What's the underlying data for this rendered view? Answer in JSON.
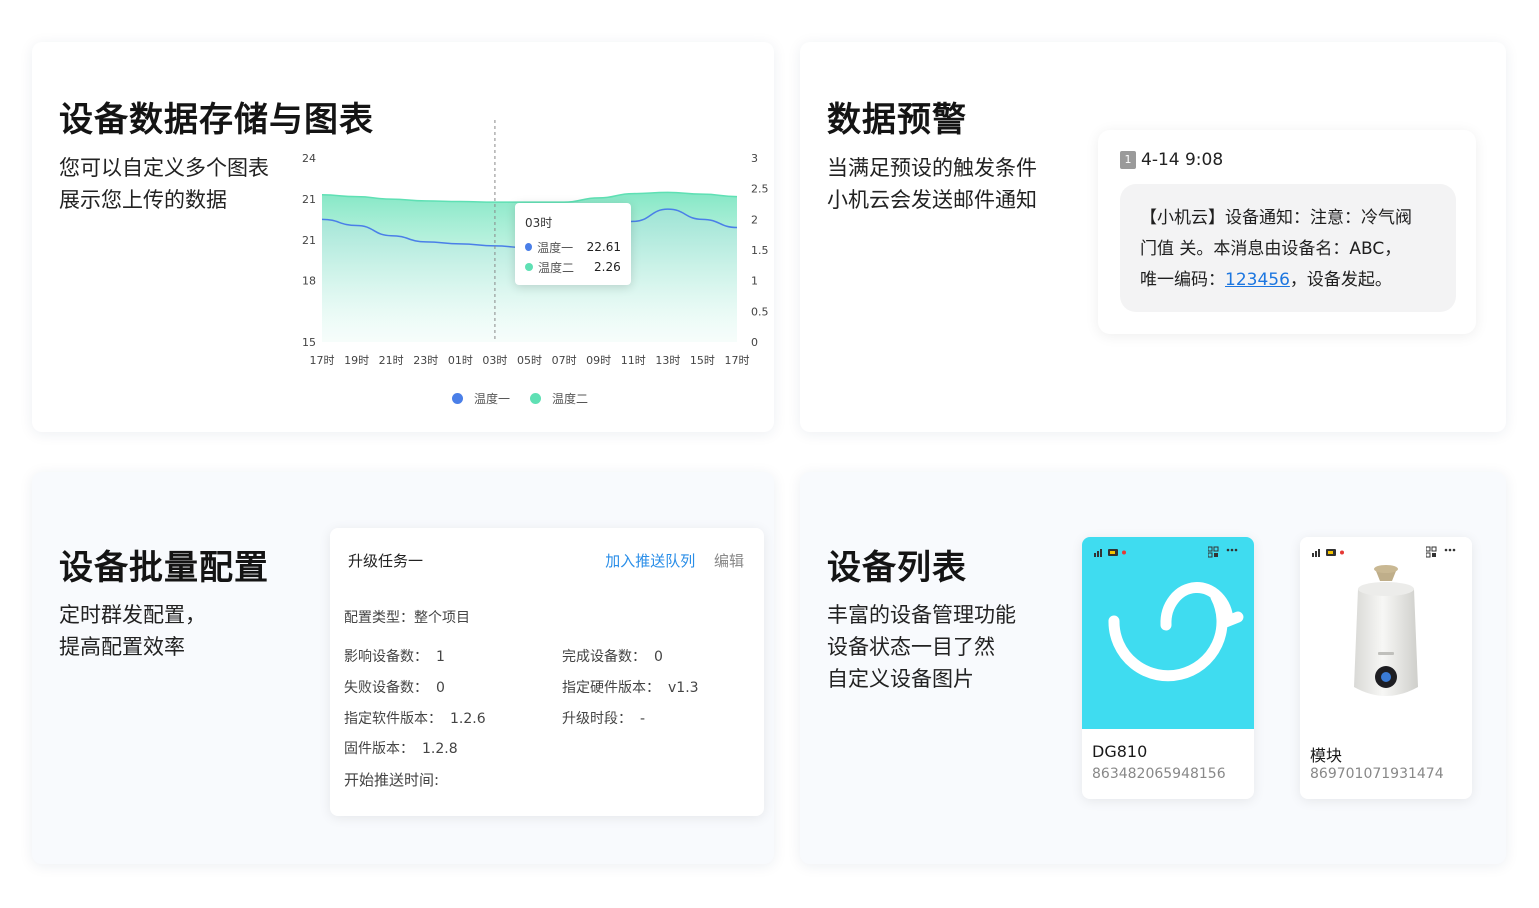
{
  "storage": {
    "title": "设备数据存储与图表",
    "desc_line1": "您可以自定义多个图表",
    "desc_line2": "展示您上传的数据"
  },
  "chart_data": {
    "type": "area",
    "x": [
      "17时",
      "19时",
      "21时",
      "23时",
      "01时",
      "03时",
      "05时",
      "07时",
      "09时",
      "11时",
      "13时",
      "15时",
      "17时"
    ],
    "left_axis_ticks": [
      "24",
      "21",
      "21",
      "18",
      "15"
    ],
    "right_axis_ticks": [
      "3",
      "2.5",
      "2",
      "1.5",
      "1",
      "0.5",
      "0"
    ],
    "series": [
      {
        "name": "温度一",
        "color": "#4a7fe8",
        "values": [
          21.0,
          20.7,
          20.2,
          19.9,
          19.8,
          19.7,
          19.6,
          19.8,
          20.4,
          20.9,
          21.5,
          21.0,
          20.6
        ]
      },
      {
        "name": "温度二",
        "color": "#5fe0b4",
        "values": [
          2.4,
          2.37,
          2.33,
          2.3,
          2.29,
          2.28,
          2.28,
          2.28,
          2.35,
          2.42,
          2.44,
          2.41,
          2.37
        ]
      }
    ],
    "tooltip": {
      "x": "03时",
      "rows": [
        {
          "name": "温度一",
          "value": "22.61",
          "color": "#4a7fe8"
        },
        {
          "name": "温度二",
          "value": "2.26",
          "color": "#5fe0b4"
        }
      ]
    },
    "legend_position": "bottom-center",
    "grid": false
  },
  "alert": {
    "title": "数据预警",
    "desc_line1": "当满足预设的触发条件",
    "desc_line2": "小机云会发送邮件通知",
    "badge": "1",
    "time": "4-14 9:08",
    "msg_line1": "【小机云】设备通知：注意：冷气阀",
    "msg_line2": "门值 关。本消息由设备名：ABC，",
    "msg_line3_prefix": "唯一编码：",
    "msg_link": "123456",
    "msg_line3_suffix": "，设备发起。"
  },
  "batch": {
    "title": "设备批量配置",
    "desc_line1": "定时群发配置，",
    "desc_line2": "提高配置效率",
    "task_name": "升级任务一",
    "action_queue": "加入推送队列",
    "action_edit": "编辑",
    "config_type_label": "配置类型：",
    "config_type_value": "整个项目",
    "affected_label": "影响设备数：",
    "affected_value": "1",
    "completed_label": "完成设备数：",
    "completed_value": "0",
    "failed_label": "失败设备数：",
    "failed_value": "0",
    "hw_label": "指定硬件版本：",
    "hw_value": "v1.3",
    "sw_label": "指定软件版本：",
    "sw_value": "1.2.6",
    "period_label": "升级时段：",
    "period_value": "-",
    "fw_label": "固件版本：",
    "fw_value": "1.2.8",
    "start_label": "开始推送时间:"
  },
  "devices": {
    "title": "设备列表",
    "desc_line1": "丰富的设备管理功能",
    "desc_line2": "设备状态一目了然",
    "desc_line3": "自定义设备图片",
    "items": [
      {
        "name": "DG810",
        "id": "863482065948156",
        "bg": "#3fdcf0"
      },
      {
        "name": "模块",
        "id": "869701071931474",
        "bg": "#ffffff"
      }
    ]
  }
}
